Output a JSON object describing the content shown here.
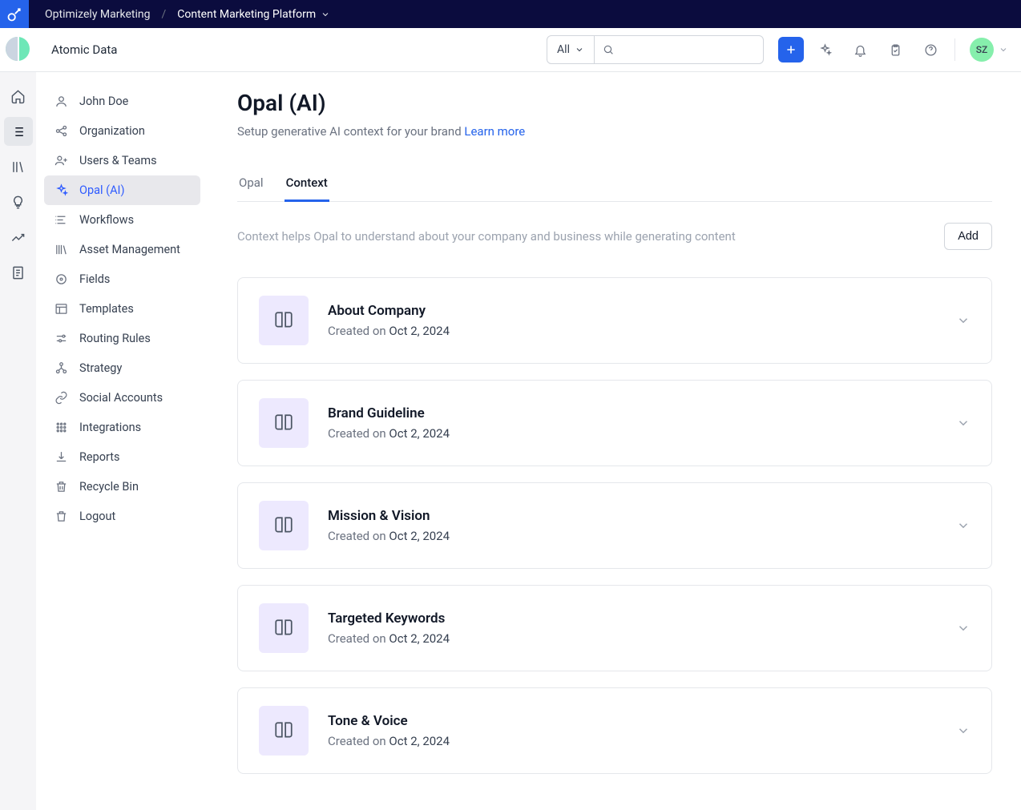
{
  "topbar": {
    "breadcrumb_root": "Optimizely Marketing",
    "breadcrumb_current": "Content Marketing Platform"
  },
  "header": {
    "org_name": "Atomic Data",
    "search_filter": "All",
    "search_placeholder": "",
    "avatar_initials": "SZ"
  },
  "sidebar": {
    "items": [
      {
        "label": "John Doe"
      },
      {
        "label": "Organization"
      },
      {
        "label": "Users & Teams"
      },
      {
        "label": "Opal (AI)"
      },
      {
        "label": "Workflows"
      },
      {
        "label": "Asset Management"
      },
      {
        "label": "Fields"
      },
      {
        "label": "Templates"
      },
      {
        "label": "Routing Rules"
      },
      {
        "label": "Strategy"
      },
      {
        "label": "Social Accounts"
      },
      {
        "label": "Integrations"
      },
      {
        "label": "Reports"
      },
      {
        "label": "Recycle Bin"
      },
      {
        "label": "Logout"
      }
    ]
  },
  "page": {
    "title": "Opal (AI)",
    "subtitle": "Setup generative AI context for your brand ",
    "learn_more": "Learn more",
    "tabs": [
      {
        "label": "Opal"
      },
      {
        "label": "Context"
      }
    ],
    "section_desc": "Context helps Opal to understand about your company and business while generating content",
    "add_button": "Add",
    "created_prefix": "Created on ",
    "cards": [
      {
        "title": "About Company",
        "date": "Oct 2, 2024"
      },
      {
        "title": "Brand Guideline",
        "date": "Oct 2, 2024"
      },
      {
        "title": "Mission & Vision",
        "date": "Oct 2, 2024"
      },
      {
        "title": "Targeted Keywords",
        "date": "Oct 2, 2024"
      },
      {
        "title": "Tone & Voice",
        "date": "Oct 2, 2024"
      }
    ]
  }
}
